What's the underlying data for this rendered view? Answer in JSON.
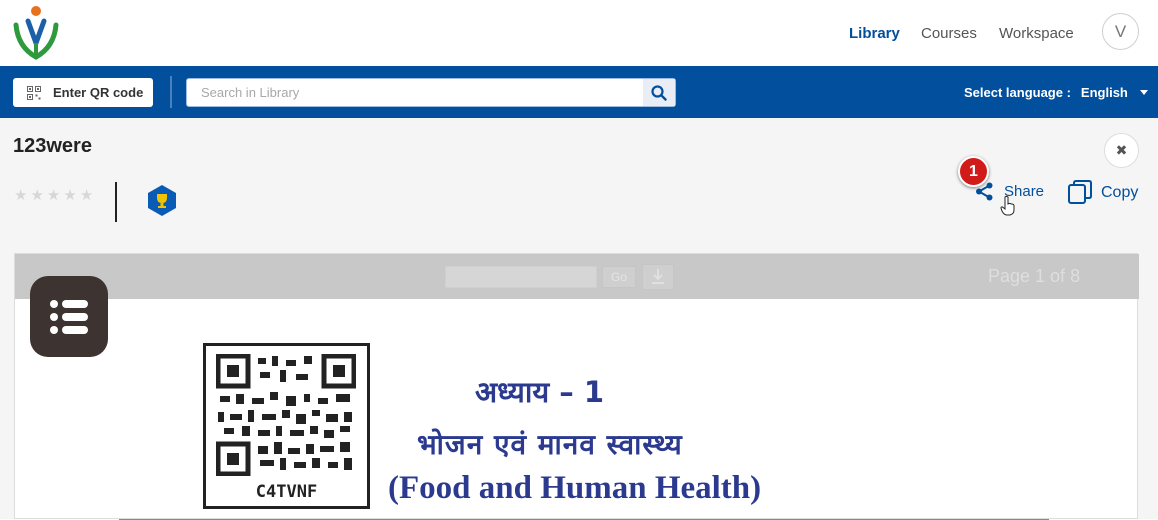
{
  "header": {
    "nav": [
      {
        "label": "Library",
        "active": true
      },
      {
        "label": "Courses",
        "active": false
      },
      {
        "label": "Workspace",
        "active": false
      }
    ],
    "avatar_initial": "V"
  },
  "toolbar": {
    "qr_button_label": "Enter QR code",
    "search_placeholder": "Search in Library",
    "language_label": "Select language :",
    "language_value": "English"
  },
  "content": {
    "title": "123were",
    "rating": {
      "filled": 0,
      "max": 5
    },
    "share_label": "Share",
    "copy_label": "Copy",
    "step_marker": "1"
  },
  "viewer": {
    "go_label": "Go",
    "page_indicator": "Page 1 of 8",
    "qr_code_text": "C4TVNF",
    "heading_hindi": "अध्याय – 1",
    "subtitle_hindi": "भोजन एवं मानव स्वास्थ्य",
    "subtitle_english": "(Food and Human Health)"
  },
  "colors": {
    "brand_blue": "#024f9d",
    "doc_text": "#2b3a8f",
    "badge_red": "#d11a1a"
  }
}
